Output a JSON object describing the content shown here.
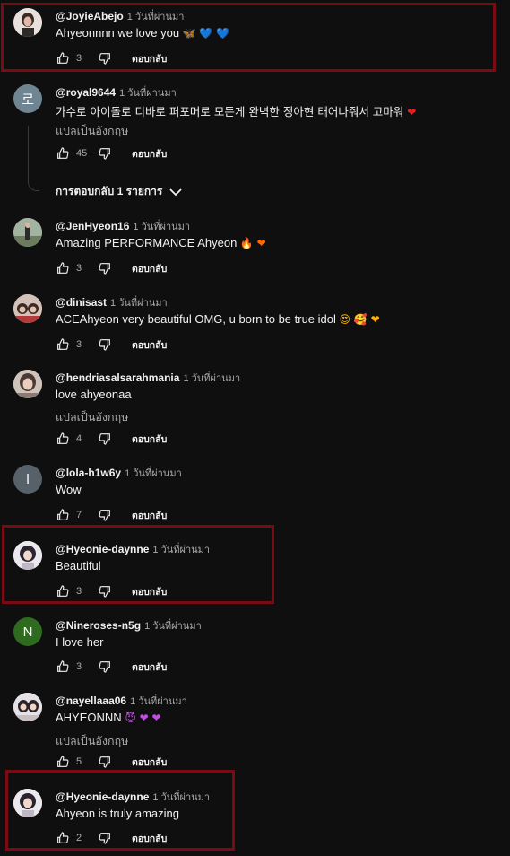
{
  "time_ago": "1 วันที่ผ่านมา",
  "reply_label": "ตอบกลับ",
  "translate_label": "แปลเป็นอังกฤษ",
  "replies_toggle_label": "การตอบกลับ 1 รายการ",
  "comments": [
    {
      "author": "@JoyieAbejo",
      "text": "Ahyeonnnn we love you",
      "emoji": "🦋 💙 💙",
      "likes": "3",
      "avatar_letter": "",
      "highlighted": true
    },
    {
      "author": "@royal9644",
      "text": "가수로 아이돌로 디바로 퍼포머로 모든게 완벽한 정아현 태어나줘서 고마워",
      "emoji": "❤",
      "likes": "45",
      "avatar_letter": "로",
      "has_translate": true,
      "has_replies": true
    },
    {
      "author": "@JenHyeon16",
      "text": "Amazing PERFORMANCE Ahyeon",
      "emoji": "🔥 ❤",
      "likes": "3",
      "avatar_letter": ""
    },
    {
      "author": "@dinisast",
      "text": "ACEAhyeon very beautiful OMG, u born to be true idol",
      "emoji": "😍 🥰 ❤",
      "likes": "3",
      "avatar_letter": ""
    },
    {
      "author": "@hendriasalsarahmania",
      "text": "love ahyeonaa",
      "emoji": "",
      "likes": "4",
      "avatar_letter": "",
      "has_translate": true
    },
    {
      "author": "@lola-h1w6y",
      "text": "Wow",
      "emoji": "",
      "likes": "7",
      "avatar_letter": "l"
    },
    {
      "author": "@Hyeonie-daynne",
      "text": "Beautiful",
      "emoji": "",
      "likes": "3",
      "avatar_letter": "",
      "highlighted": true
    },
    {
      "author": "@Nineroses-n5g",
      "text": "I love her",
      "emoji": "",
      "likes": "3",
      "avatar_letter": "N"
    },
    {
      "author": "@nayellaaa06",
      "text": "AHYEONNN",
      "emoji": "😈 ❤ ❤",
      "likes": "5",
      "avatar_letter": "",
      "has_translate": true
    },
    {
      "author": "@Hyeonie-daynne",
      "text": "Ahyeon is truly amazing",
      "emoji": "",
      "likes": "2",
      "avatar_letter": "",
      "highlighted": true
    }
  ],
  "colors": {
    "background": "#0f0f0f",
    "highlight_border": "#7a0a14",
    "secondary_text": "#aaaaaa",
    "avatar_royal": "#6f8592",
    "avatar_lola": "#56616a",
    "avatar_nineroses": "#2f6b1e"
  }
}
